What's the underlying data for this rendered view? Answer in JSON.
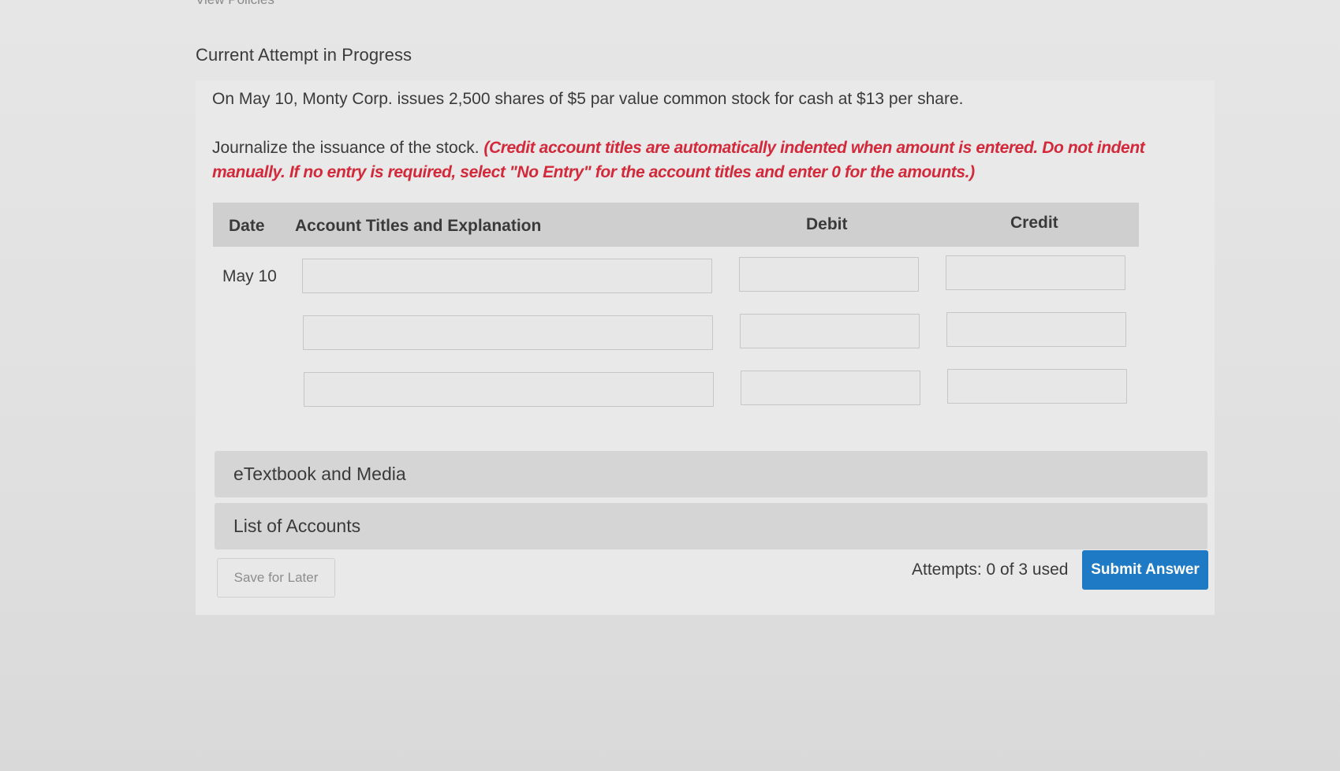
{
  "nav": {
    "top_link": "View Policies"
  },
  "status": {
    "attempt_title": "Current Attempt in Progress"
  },
  "question": {
    "text": "On May 10, Monty Corp. issues 2,500 shares of $5 par value common stock for cash at $13 per share.",
    "instruction_lead": "Journalize the issuance of the stock.",
    "instruction_note": "(Credit account titles are automatically indented when amount is entered. Do not indent manually. If no entry is required, select \"No Entry\" for the account titles and enter 0 for the amounts.)"
  },
  "journal": {
    "headers": {
      "date": "Date",
      "account": "Account Titles and Explanation",
      "debit": "Debit",
      "credit": "Credit"
    },
    "date": "May 10",
    "rows": [
      {
        "account": "",
        "debit": "",
        "credit": ""
      },
      {
        "account": "",
        "debit": "",
        "credit": ""
      },
      {
        "account": "",
        "debit": "",
        "credit": ""
      }
    ]
  },
  "resources": {
    "etextbook": "eTextbook and Media",
    "accounts": "List of Accounts"
  },
  "footer": {
    "save_label": "Save for Later",
    "attempts": "Attempts: 0 of 3 used",
    "submit_label": "Submit Answer"
  },
  "colors": {
    "accent": "#1e7ac4",
    "instruction_red": "#d3293a",
    "header_bg": "#cfcfcf"
  }
}
